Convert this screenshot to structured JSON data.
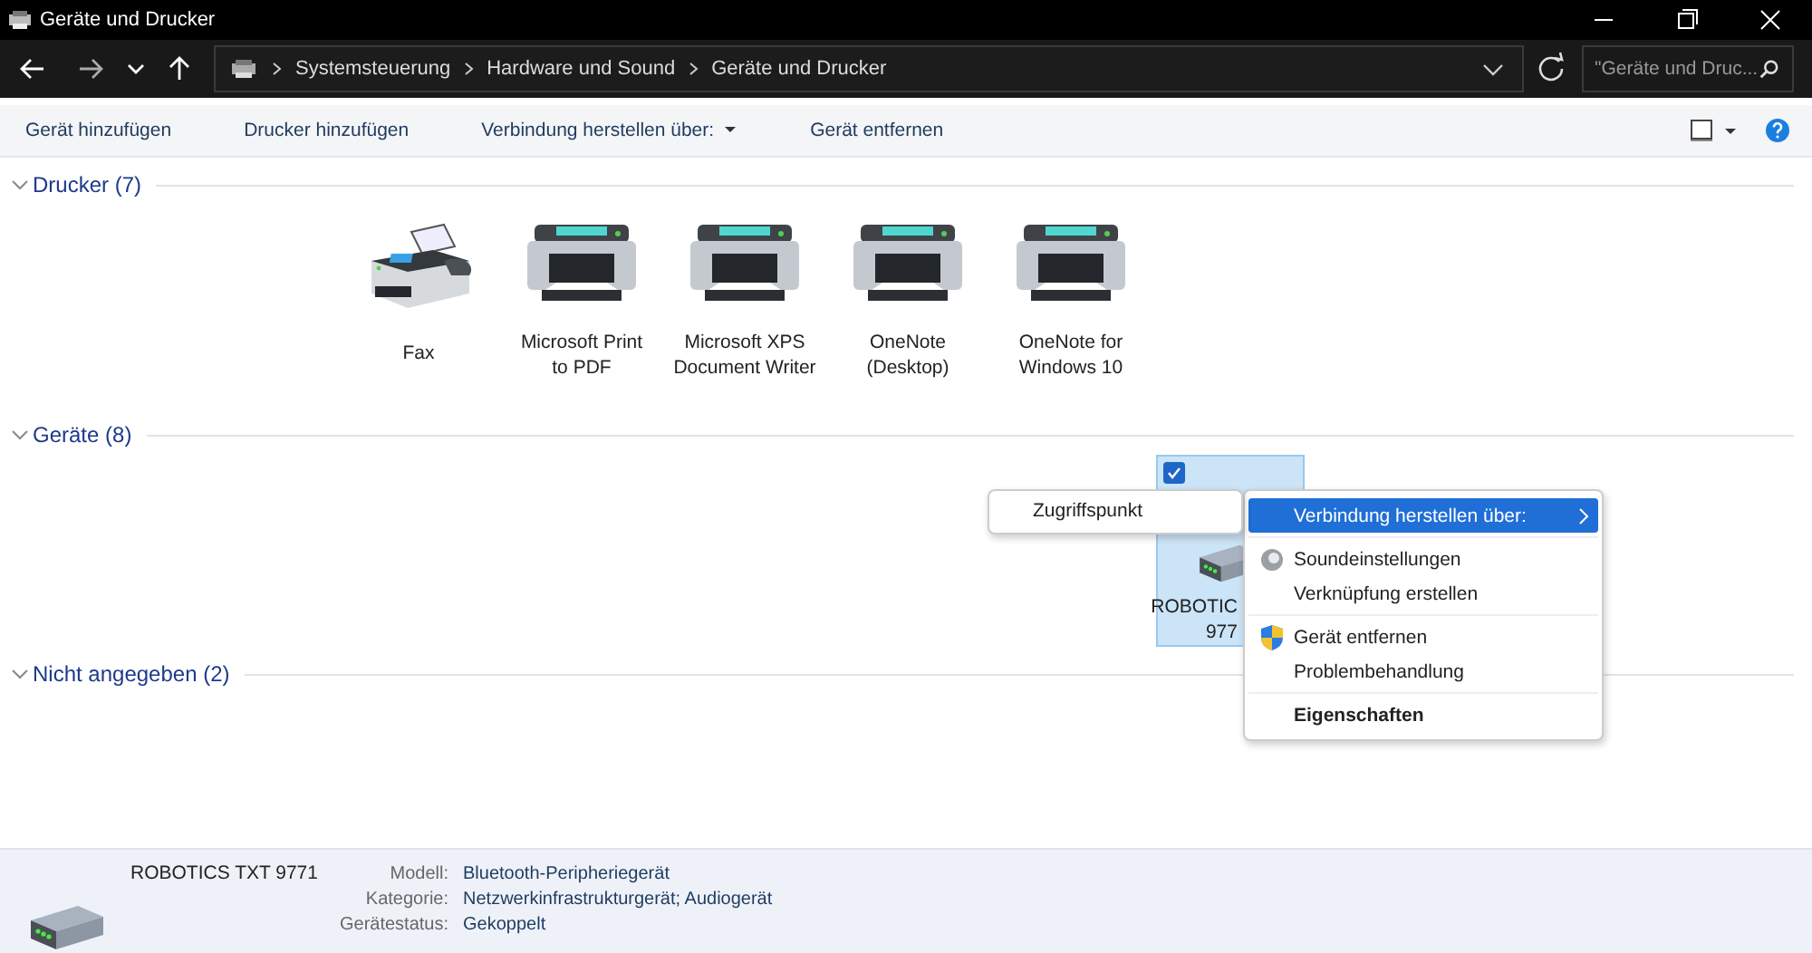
{
  "window": {
    "title": "Geräte und Drucker"
  },
  "address_bar": {
    "breadcrumbs": [
      "Systemsteuerung",
      "Hardware und Sound",
      "Geräte und Drucker"
    ]
  },
  "search": {
    "placeholder": "\"Geräte und Druc..."
  },
  "toolbar": [
    {
      "label": "Gerät hinzufügen",
      "kind": "button"
    },
    {
      "label": "Drucker hinzufügen",
      "kind": "button"
    },
    {
      "label": "Verbindung herstellen über:",
      "kind": "dropdown"
    },
    {
      "label": "Gerät entfernen",
      "kind": "button"
    }
  ],
  "groups": [
    {
      "title": "Drucker (7)",
      "expanded": true,
      "kind": "printers",
      "items": [
        {
          "kind": "fax",
          "label": [
            "Fax"
          ],
          "selected": false,
          "checked": false
        },
        {
          "kind": "printer",
          "label": [
            "Microsoft Print",
            "to PDF"
          ],
          "selected": false,
          "checked": false
        },
        {
          "kind": "printer",
          "label": [
            "Microsoft XPS",
            "Document Writer"
          ],
          "selected": false,
          "checked": false
        },
        {
          "kind": "printer",
          "label": [
            "OneNote",
            "(Desktop)"
          ],
          "selected": false,
          "checked": false
        },
        {
          "kind": "printer",
          "label": [
            "OneNote for",
            "Windows 10"
          ],
          "selected": false,
          "checked": false
        }
      ]
    },
    {
      "title": "Geräte (8)",
      "expanded": true,
      "kind": "devices",
      "items": [
        {
          "kind": "device",
          "label": [
            "ROBOTIC",
            "977"
          ],
          "selected": true,
          "checked": true
        }
      ]
    },
    {
      "title": "Nicht angegeben (2)",
      "expanded": true,
      "kind": "other"
    }
  ],
  "context_menu": {
    "items": [
      {
        "kind": "plain",
        "label": "Verbindung herstellen über:",
        "submenu": true,
        "selected": true,
        "default": false
      },
      {
        "kind": "separator"
      },
      {
        "kind": "sound",
        "label": "Soundeinstellungen",
        "submenu": false,
        "selected": false,
        "default": false
      },
      {
        "kind": "plain",
        "label": "Verknüpfung erstellen",
        "submenu": false,
        "selected": false,
        "default": false
      },
      {
        "kind": "separator"
      },
      {
        "kind": "shield",
        "label": "Gerät entfernen",
        "submenu": false,
        "selected": false,
        "default": false
      },
      {
        "kind": "plain",
        "label": "Problembehandlung",
        "submenu": false,
        "selected": false,
        "default": false
      },
      {
        "kind": "separator"
      },
      {
        "kind": "plain",
        "label": "Eigenschaften",
        "submenu": false,
        "selected": false,
        "default": true
      }
    ]
  },
  "submenu": {
    "items": [
      {
        "label": "Zugriffspunkt",
        "selected": false
      }
    ]
  },
  "details": {
    "name": "ROBOTICS TXT 9771",
    "fields": [
      {
        "label": "Modell:",
        "value": "Bluetooth-Peripheriegerät"
      },
      {
        "label": "Kategorie:",
        "value": "Netzwerkinfrastrukturgerät; Audiogerät"
      },
      {
        "label": "Gerätestatus:",
        "value": "Gekoppelt"
      }
    ]
  }
}
